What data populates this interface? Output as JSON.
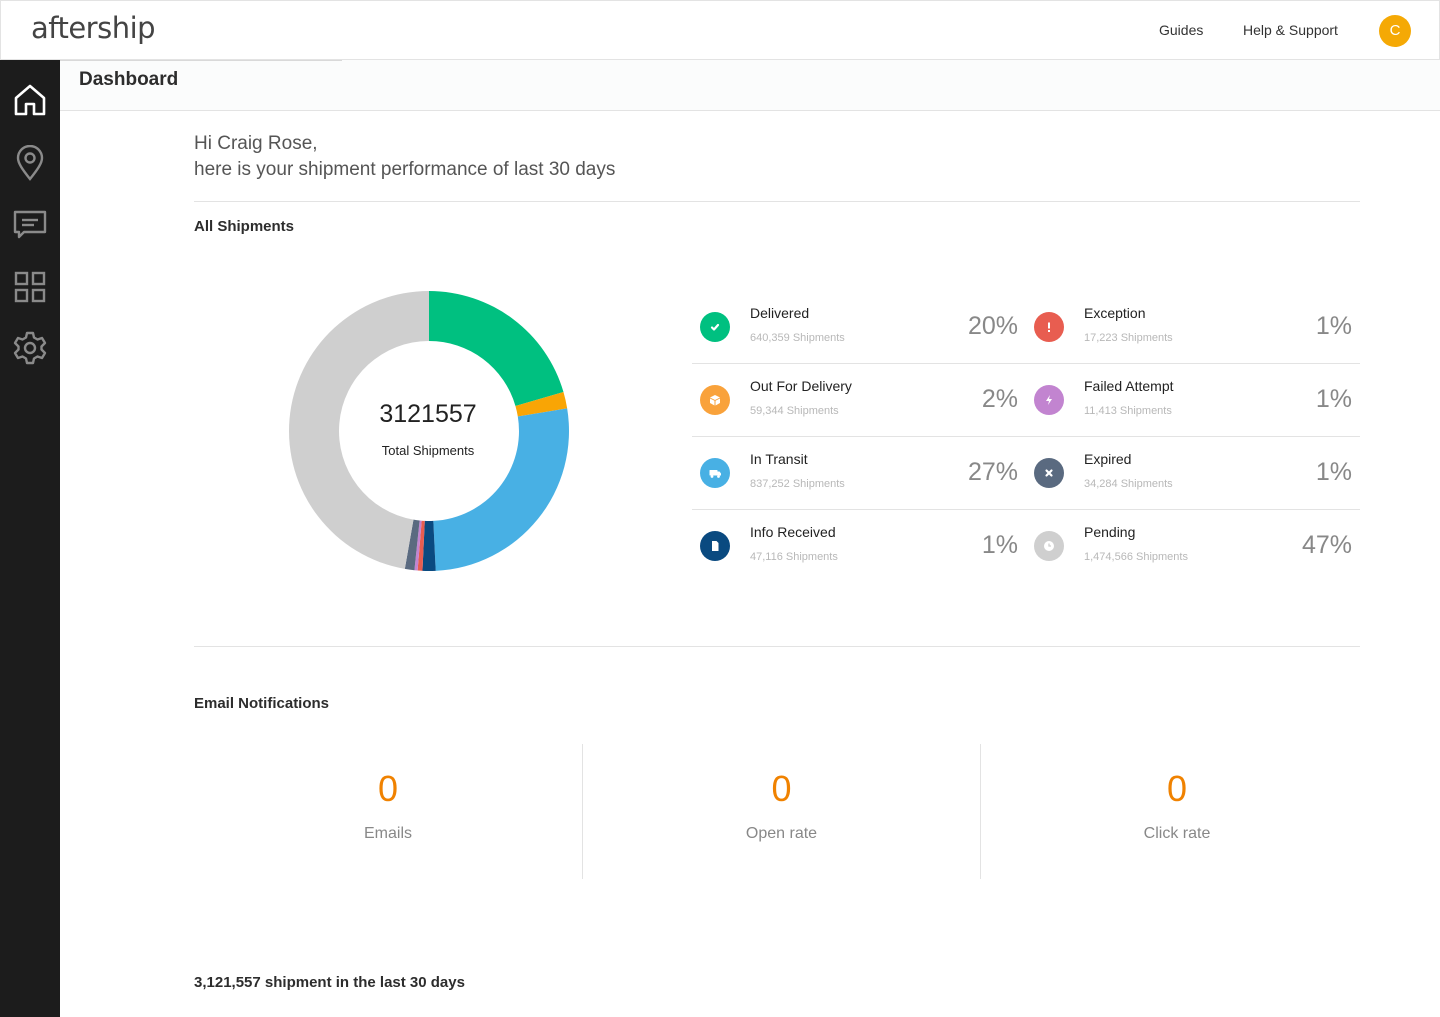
{
  "app": {
    "logo": "aftership",
    "nav_links": [
      "Guides",
      "Help & Support"
    ],
    "avatar_initial": "C",
    "avatar_color": "#f5a905"
  },
  "sidebar": {
    "items": [
      {
        "name": "home",
        "icon": "home-icon",
        "active": true
      },
      {
        "name": "tracking",
        "icon": "location-pin-icon",
        "active": false
      },
      {
        "name": "notifications",
        "icon": "message-icon",
        "active": false
      },
      {
        "name": "apps",
        "icon": "grid-icon",
        "active": false
      },
      {
        "name": "settings",
        "icon": "gear-icon",
        "active": false
      }
    ]
  },
  "header": {
    "title": "Dashboard"
  },
  "greeting": {
    "line1": "Hi Craig Rose,",
    "line2": "here is your shipment performance of last 30 days"
  },
  "all_shipments": {
    "title": "All Shipments",
    "total": "3121557",
    "total_label": "Total Shipments"
  },
  "statuses": [
    {
      "key": "delivered",
      "name": "Delivered",
      "count": "640,359 Shipments",
      "value": 640359,
      "pct": "20%",
      "color": "#00c080",
      "icon": "check-icon"
    },
    {
      "key": "exception",
      "name": "Exception",
      "count": "17,223 Shipments",
      "value": 17223,
      "pct": "1%",
      "color": "#e85d50",
      "icon": "exclamation-icon"
    },
    {
      "key": "out_for_delivery",
      "name": "Out For Delivery",
      "count": "59,344 Shipments",
      "value": 59344,
      "pct": "2%",
      "color": "#f9a23b",
      "icon": "box-icon"
    },
    {
      "key": "failed_attempt",
      "name": "Failed Attempt",
      "count": "11,413 Shipments",
      "value": 11413,
      "pct": "1%",
      "color": "#c284d0",
      "icon": "lightning-icon"
    },
    {
      "key": "in_transit",
      "name": "In Transit",
      "count": "837,252 Shipments",
      "value": 837252,
      "pct": "27%",
      "color": "#48b0e4",
      "icon": "truck-icon"
    },
    {
      "key": "expired",
      "name": "Expired",
      "count": "34,284 Shipments",
      "value": 34284,
      "pct": "1%",
      "color": "#5a6a80",
      "icon": "x-icon"
    },
    {
      "key": "info_received",
      "name": "Info Received",
      "count": "47,116 Shipments",
      "value": 47116,
      "pct": "1%",
      "color": "#0a4a80",
      "icon": "document-icon"
    },
    {
      "key": "pending",
      "name": "Pending",
      "count": "1,474,566 Shipments",
      "value": 1474566,
      "pct": "47%",
      "color": "#cfcfcf",
      "icon": "clock-icon"
    }
  ],
  "chart_data": {
    "type": "pie",
    "title": "All Shipments",
    "center_value": "3121557",
    "center_label": "Total Shipments",
    "categories": [
      "Delivered",
      "Out For Delivery",
      "In Transit",
      "Info Received",
      "Exception",
      "Failed Attempt",
      "Expired",
      "Pending"
    ],
    "values": [
      640359,
      59344,
      837252,
      47116,
      17223,
      11413,
      34284,
      1474566
    ],
    "colors": [
      "#00c080",
      "#f9a505",
      "#48b0e4",
      "#0a4a80",
      "#e85d50",
      "#c284d0",
      "#5a6a80",
      "#cfcfcf"
    ],
    "donut": true
  },
  "email_notifications": {
    "title": "Email Notifications",
    "cards": [
      {
        "value": "0",
        "label": "Emails"
      },
      {
        "value": "0",
        "label": "Open rate"
      },
      {
        "value": "0",
        "label": "Click rate"
      }
    ],
    "accent_color": "#f08200"
  },
  "footer": {
    "summary": "3,121,557 shipment in the last 30 days"
  }
}
